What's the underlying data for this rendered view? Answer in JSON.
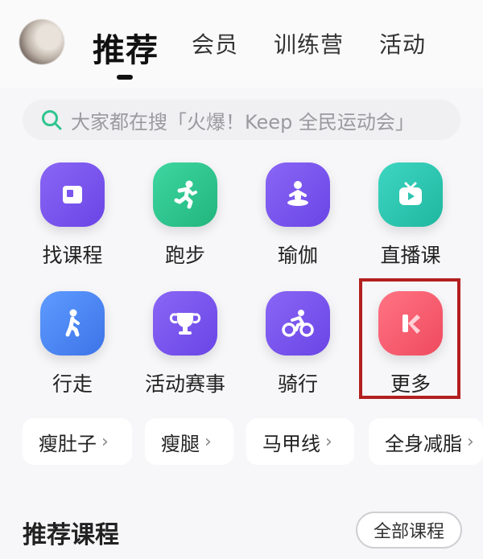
{
  "header": {
    "tabs": [
      {
        "label": "推荐",
        "active": true
      },
      {
        "label": "会员",
        "active": false
      },
      {
        "label": "训练营",
        "active": false
      },
      {
        "label": "活动",
        "active": false
      }
    ]
  },
  "search": {
    "text": "大家都在搜「火爆！Keep 全民运动会」",
    "icon": "search-icon"
  },
  "grid": [
    {
      "label": "找课程",
      "icon": "course-book-icon",
      "color": "#7b55f0"
    },
    {
      "label": "跑步",
      "icon": "running-icon",
      "color": "#2fc58f"
    },
    {
      "label": "瑜伽",
      "icon": "yoga-icon",
      "color": "#7b55f0"
    },
    {
      "label": "直播课",
      "icon": "live-tv-icon",
      "color": "#2fc5b0"
    },
    {
      "label": "行走",
      "icon": "walking-icon",
      "color": "#4d8cf5"
    },
    {
      "label": "活动赛事",
      "icon": "trophy-icon",
      "color": "#7b55f0"
    },
    {
      "label": "骑行",
      "icon": "cycling-icon",
      "color": "#7b55f0"
    },
    {
      "label": "更多",
      "icon": "keep-k-icon",
      "color": "#f5596b"
    }
  ],
  "chips": [
    {
      "label": "瘦肚子"
    },
    {
      "label": "瘦腿"
    },
    {
      "label": "马甲线"
    },
    {
      "label": "全身减脂"
    }
  ],
  "recommend": {
    "title": "推荐课程",
    "all_label": "全部课程"
  }
}
